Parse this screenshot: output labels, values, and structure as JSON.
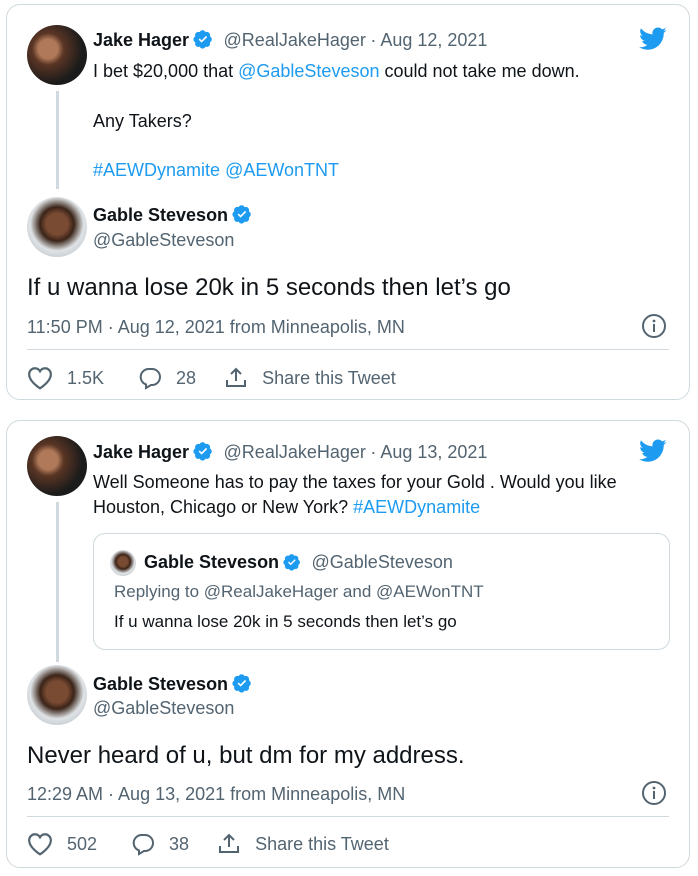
{
  "colors": {
    "accent": "#1d9bf0",
    "secondary_text": "#536471",
    "border": "#cfd9de"
  },
  "tweet1": {
    "parent": {
      "name": "Jake Hager",
      "handle": "@RealJakeHager",
      "date": "· Aug 12, 2021",
      "line1_prefix": "I bet $20,000 that ",
      "line1_mention": "@GableSteveson",
      "line1_suffix": " could not take me down.",
      "line2": "Any Takers?",
      "hashtag": "#AEWDynamite",
      "mention2": "@AEWonTNT"
    },
    "reply": {
      "name": "Gable Steveson",
      "handle": "@GableSteveson",
      "text": "If u wanna lose 20k in 5 seconds then let’s go",
      "timestamp": "11:50 PM · Aug 12, 2021 from Minneapolis, MN",
      "likes": "1.5K",
      "replies": "28",
      "share_label": "Share this Tweet"
    }
  },
  "tweet2": {
    "parent": {
      "name": "Jake Hager",
      "handle": "@RealJakeHager",
      "date": "· Aug 13, 2021",
      "line1": "Well Someone has to pay the taxes for your Gold . Would you like",
      "line2_prefix": "Houston, Chicago or New York? ",
      "hashtag": "#AEWDynamite"
    },
    "quote": {
      "name": "Gable Steveson",
      "handle": "@GableSteveson",
      "replying": "Replying to @RealJakeHager and @AEWonTNT",
      "text": "If u wanna lose 20k in 5 seconds then let’s go"
    },
    "reply": {
      "name": "Gable Steveson",
      "handle": "@GableSteveson",
      "text": "Never heard of u, but dm for my address.",
      "timestamp": "12:29 AM · Aug 13, 2021 from Minneapolis, MN",
      "likes": "502",
      "replies": "38",
      "share_label": "Share this Tweet"
    }
  }
}
